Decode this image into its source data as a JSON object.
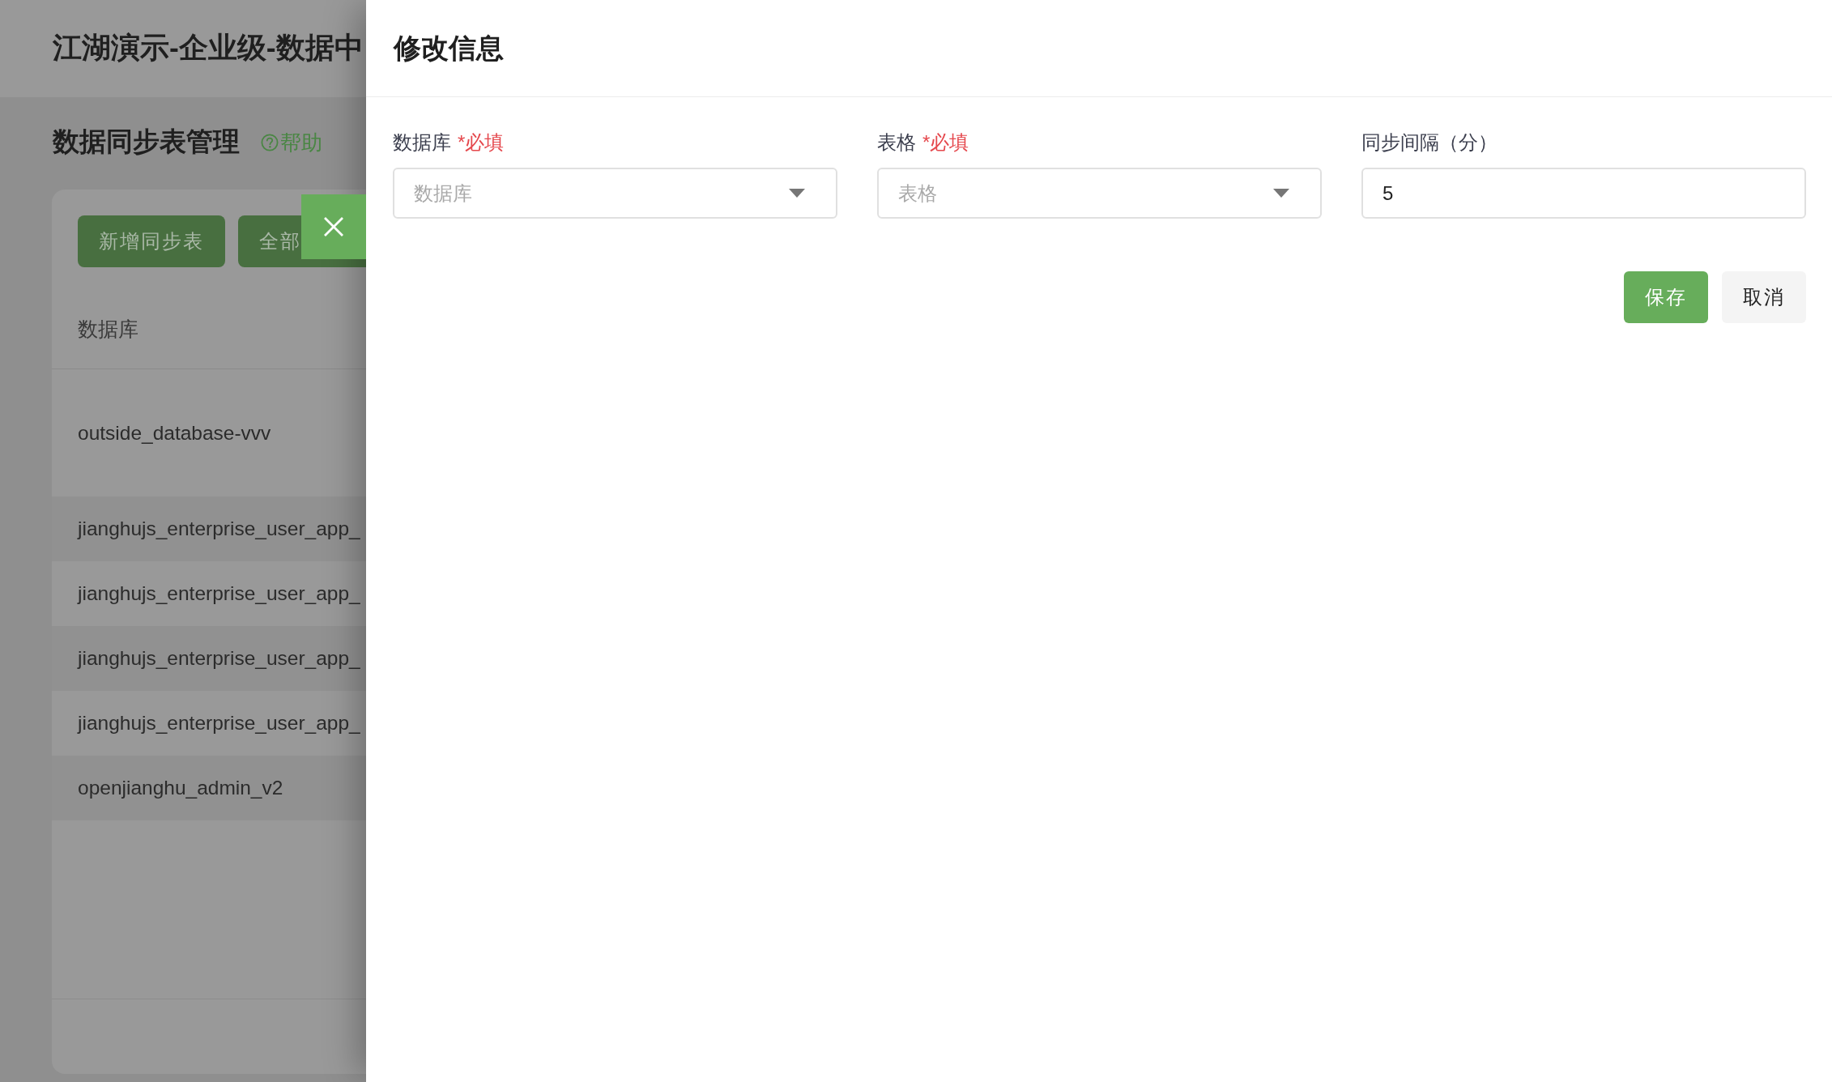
{
  "app_header": {
    "title": "江湖演示-企业级-数据中"
  },
  "page": {
    "title": "数据同步表管理",
    "help_link": "帮助"
  },
  "toolbar": {
    "buttons": [
      "新增同步表",
      "全部"
    ]
  },
  "table": {
    "columns": [
      "数据库"
    ],
    "rows": [
      {
        "cells": [
          "outside_database-vvv"
        ]
      },
      {
        "cells": [
          "jianghujs_enterprise_user_app_"
        ]
      },
      {
        "cells": [
          "jianghujs_enterprise_user_app_"
        ]
      },
      {
        "cells": [
          "jianghujs_enterprise_user_app_"
        ]
      },
      {
        "cells": [
          "jianghujs_enterprise_user_app_"
        ]
      },
      {
        "cells": [
          "openjianghu_admin_v2"
        ]
      }
    ]
  },
  "drawer": {
    "title": "修改信息",
    "fields": [
      {
        "kind": "select",
        "label": "数据库",
        "required_mark": "*必填",
        "placeholder": "数据库"
      },
      {
        "kind": "select",
        "label": "表格",
        "required_mark": "*必填",
        "placeholder": "表格"
      },
      {
        "kind": "input",
        "label": "同步间隔（分）",
        "value": "5"
      }
    ],
    "actions": [
      {
        "kind": "primary",
        "label": "保存"
      },
      {
        "kind": "default",
        "label": "取消"
      }
    ]
  }
}
